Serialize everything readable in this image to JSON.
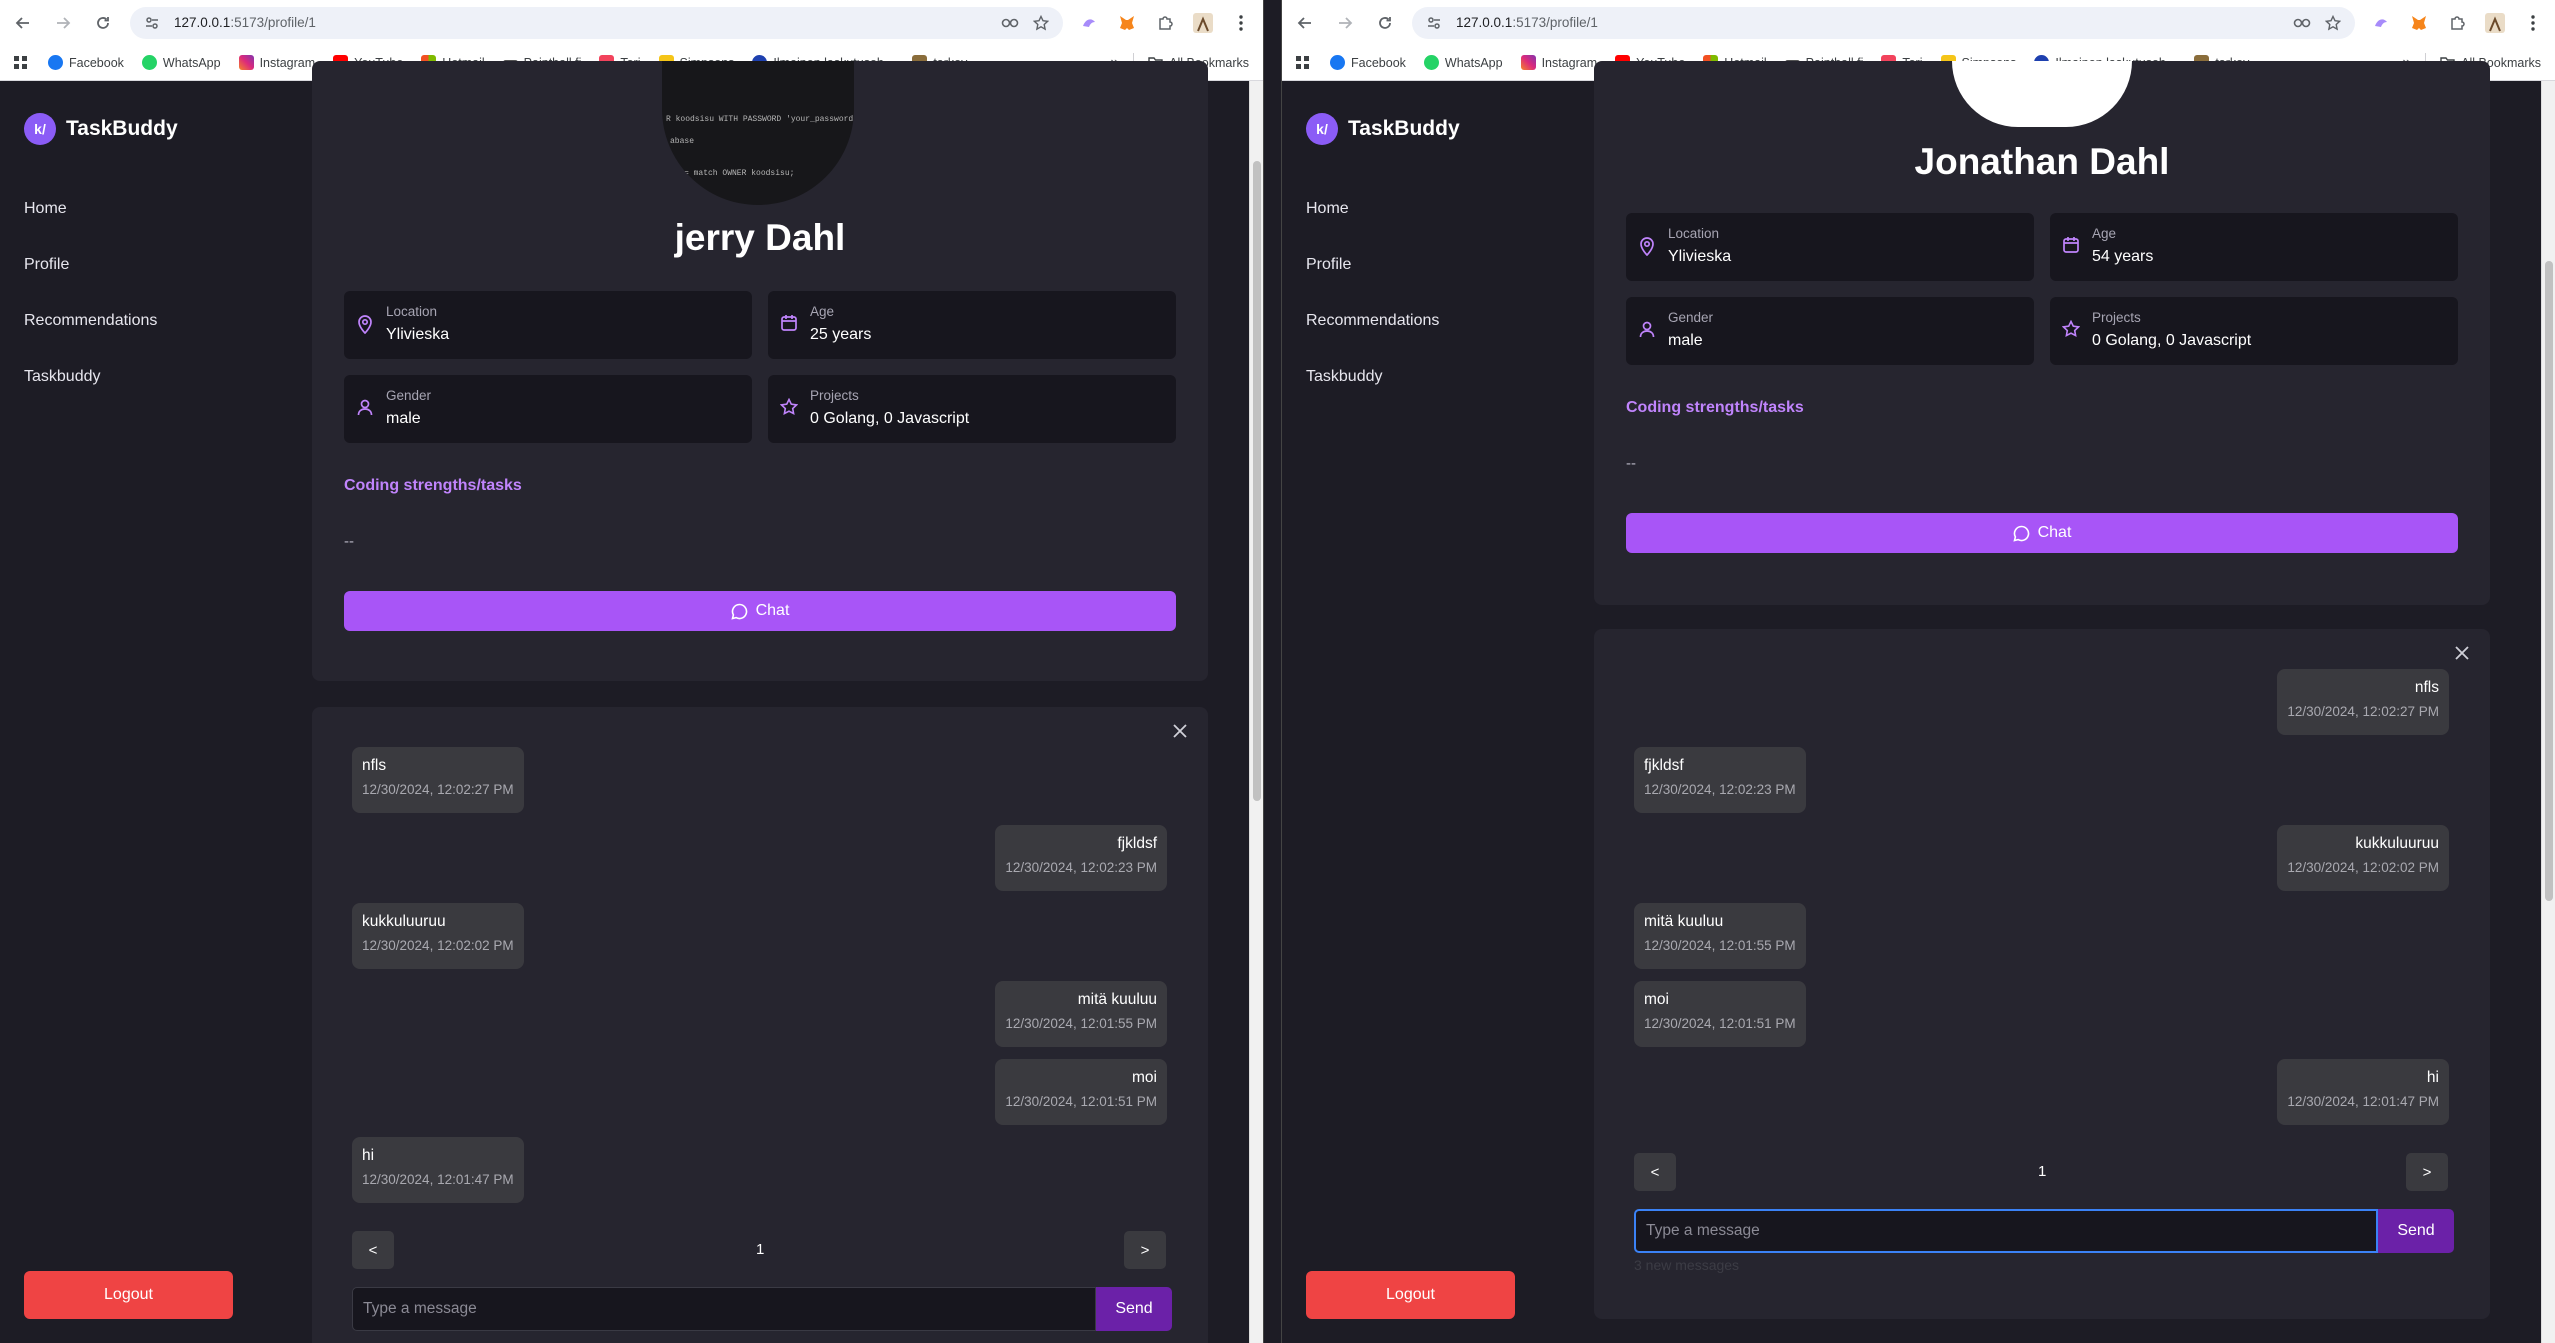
{
  "colors": {
    "accent": "#a855f7",
    "logout": "#ef4444",
    "send": "#6b21a8",
    "bg": "#1d1c25",
    "card": "#26252f",
    "msg_bubble": "#3a3a3f"
  },
  "browser": {
    "url_host": "127.0.0.1",
    "url_path": ":5173/profile/1",
    "bookmarks": [
      {
        "label": "Facebook",
        "icon": "facebook-icon"
      },
      {
        "label": "WhatsApp",
        "icon": "whatsapp-icon"
      },
      {
        "label": "Instagram",
        "icon": "instagram-icon"
      },
      {
        "label": "YouTube",
        "icon": "youtube-icon"
      },
      {
        "label": "Hotmail",
        "icon": "microsoft-icon"
      },
      {
        "label": "Paintball.fi",
        "icon": "paintball-icon"
      },
      {
        "label": "Tori",
        "icon": "tori-icon"
      },
      {
        "label": "Simpsons",
        "icon": "simpsons-icon"
      },
      {
        "label": "Ilmainen laskutusoh...",
        "icon": "laskutus-icon"
      },
      {
        "label": "tarkov",
        "icon": "tarkov-icon"
      }
    ],
    "more": "»",
    "all_bookmarks": "All Bookmarks"
  },
  "app": {
    "logo_text": "k/",
    "brand": "TaskBuddy",
    "nav": [
      "Home",
      "Profile",
      "Recommendations",
      "Taskbuddy"
    ],
    "logout": "Logout"
  },
  "left": {
    "avatar_code": [
      "R koodsisu WITH PASSWORD 'your_password'",
      "abase",
      "= match OWNER koodsisu;"
    ],
    "name": "jerry Dahl",
    "location_label": "Location",
    "location": "Ylivieska",
    "age_label": "Age",
    "age": "25 years",
    "gender_label": "Gender",
    "gender": "male",
    "projects_label": "Projects",
    "projects": "0 Golang, 0 Javascript",
    "strengths_label": "Coding strengths/tasks",
    "strengths_value": "--",
    "chat_label": "Chat",
    "messages": [
      {
        "text": "nfls",
        "date": "12/30/2024, 12:02:27 PM",
        "side": "left"
      },
      {
        "text": "fjkldsf",
        "date": "12/30/2024, 12:02:23 PM",
        "side": "right"
      },
      {
        "text": "kukkuluuruu",
        "date": "12/30/2024, 12:02:02 PM",
        "side": "left"
      },
      {
        "text": "mitä kuuluu",
        "date": "12/30/2024, 12:01:55 PM",
        "side": "right"
      },
      {
        "text": "moi",
        "date": "12/30/2024, 12:01:51 PM",
        "side": "right"
      },
      {
        "text": "hi",
        "date": "12/30/2024, 12:01:47 PM",
        "side": "left"
      }
    ],
    "prev": "<",
    "next": ">",
    "page": "1",
    "input_placeholder": "Type a message",
    "send": "Send"
  },
  "right": {
    "name": "Jonathan Dahl",
    "location_label": "Location",
    "location": "Ylivieska",
    "age_label": "Age",
    "age": "54 years",
    "gender_label": "Gender",
    "gender": "male",
    "projects_label": "Projects",
    "projects": "0 Golang, 0 Javascript",
    "strengths_label": "Coding strengths/tasks",
    "strengths_value": "--",
    "chat_label": "Chat",
    "messages": [
      {
        "text": "nfls",
        "date": "12/30/2024, 12:02:27 PM",
        "side": "right"
      },
      {
        "text": "fjkldsf",
        "date": "12/30/2024, 12:02:23 PM",
        "side": "left"
      },
      {
        "text": "kukkuluuruu",
        "date": "12/30/2024, 12:02:02 PM",
        "side": "right"
      },
      {
        "text": "mitä kuuluu",
        "date": "12/30/2024, 12:01:55 PM",
        "side": "left"
      },
      {
        "text": "moi",
        "date": "12/30/2024, 12:01:51 PM",
        "side": "left"
      },
      {
        "text": "hi",
        "date": "12/30/2024, 12:01:47 PM",
        "side": "right"
      }
    ],
    "prev": "<",
    "next": ">",
    "page": "1",
    "input_placeholder": "Type a message",
    "send": "Send",
    "new_messages": "3 new messages"
  }
}
